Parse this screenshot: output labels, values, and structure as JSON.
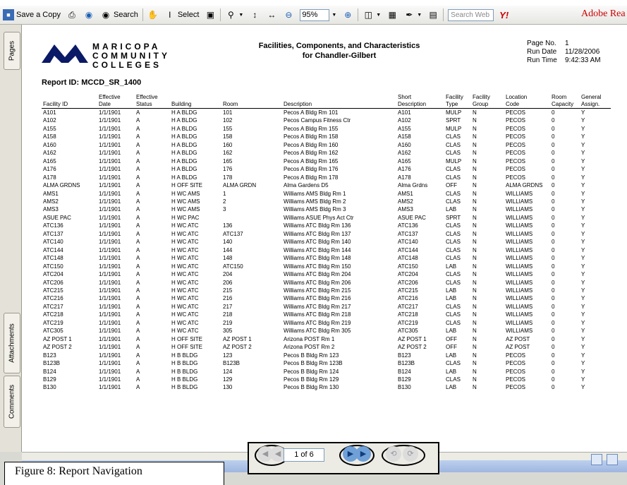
{
  "toolbar": {
    "save_copy": "Save a Copy",
    "search": "Search",
    "select": "Select",
    "zoom": "95%",
    "search_web_placeholder": "Search Web",
    "yahoo": "Y!",
    "adobe": "Adobe Rea"
  },
  "side_tabs": {
    "pages": "Pages",
    "attachments": "Attachments",
    "comments": "Comments"
  },
  "report": {
    "logo_lines": [
      "MARICOPA",
      "COMMUNITY",
      "COLLEGES"
    ],
    "report_id": "Report ID: MCCD_SR_1400",
    "title_line1": "Facilities, Components, and Characteristics",
    "title_line2": "for Chandler-Gilbert",
    "page_no_label": "Page No.",
    "page_no": "1",
    "run_date_label": "Run Date",
    "run_date": "11/28/2006",
    "run_time_label": "Run Time",
    "run_time": "9:42:33 AM",
    "headers": [
      [
        "",
        "Facility ID"
      ],
      [
        "Effective",
        "Date"
      ],
      [
        "Effective",
        "Status"
      ],
      [
        "",
        "Building"
      ],
      [
        "",
        "Room"
      ],
      [
        "",
        "Description"
      ],
      [
        "Short",
        "Description"
      ],
      [
        "Facility",
        "Type"
      ],
      [
        "Facility",
        "Group"
      ],
      [
        "Location",
        "Code"
      ],
      [
        "Room",
        "Capacity"
      ],
      [
        "General",
        "Assign."
      ]
    ],
    "rows": [
      [
        "A101",
        "1/1/1901",
        "A",
        "H A BLDG",
        "101",
        "Pecos A Bldg Rm 101",
        "A101",
        "MULP",
        "N",
        "PECOS",
        "0",
        "Y"
      ],
      [
        "A102",
        "1/1/1901",
        "A",
        "H A BLDG",
        "102",
        "Pecos Campus Fitness Ctr",
        "A102",
        "SPRT",
        "N",
        "PECOS",
        "0",
        "Y"
      ],
      [
        "A155",
        "1/1/1901",
        "A",
        "H A BLDG",
        "155",
        "Pecos A Bldg Rm 155",
        "A155",
        "MULP",
        "N",
        "PECOS",
        "0",
        "Y"
      ],
      [
        "A158",
        "1/1/1901",
        "A",
        "H A BLDG",
        "158",
        "Pecos A Bldg Rm 158",
        "A158",
        "CLAS",
        "N",
        "PECOS",
        "0",
        "Y"
      ],
      [
        "A160",
        "1/1/1901",
        "A",
        "H A BLDG",
        "160",
        "Pecos A Bldg Rm 160",
        "A160",
        "CLAS",
        "N",
        "PECOS",
        "0",
        "Y"
      ],
      [
        "A162",
        "1/1/1901",
        "A",
        "H A BLDG",
        "162",
        "Pecos A Bldg Rm 162",
        "A162",
        "CLAS",
        "N",
        "PECOS",
        "0",
        "Y"
      ],
      [
        "A165",
        "1/1/1901",
        "A",
        "H A BLDG",
        "165",
        "Pecos A Bldg Rm 165",
        "A165",
        "MULP",
        "N",
        "PECOS",
        "0",
        "Y"
      ],
      [
        "A176",
        "1/1/1901",
        "A",
        "H A BLDG",
        "176",
        "Pecos A Bldg Rm 176",
        "A176",
        "CLAS",
        "N",
        "PECOS",
        "0",
        "Y"
      ],
      [
        "A178",
        "1/1/1901",
        "A",
        "H A BLDG",
        "178",
        "Pecos A Bldg Rm 178",
        "A178",
        "CLAS",
        "N",
        "PECOS",
        "0",
        "Y"
      ],
      [
        "ALMA GRDNS",
        "1/1/1901",
        "A",
        "H OFF SITE",
        "ALMA GRDN",
        "Alma Gardens D5",
        "Alma Grdns",
        "OFF",
        "N",
        "ALMA GRDNS",
        "0",
        "Y"
      ],
      [
        "AMS1",
        "1/1/1901",
        "A",
        "H WC AMS",
        "1",
        "Williams AMS Bldg Rm 1",
        "AMS1",
        "CLAS",
        "N",
        "WILLIAMS",
        "0",
        "Y"
      ],
      [
        "AMS2",
        "1/1/1901",
        "A",
        "H WC AMS",
        "2",
        "Williams AMS Bldg Rm 2",
        "AMS2",
        "CLAS",
        "N",
        "WILLIAMS",
        "0",
        "Y"
      ],
      [
        "AMS3",
        "1/1/1901",
        "A",
        "H WC AMS",
        "3",
        "Williams AMS Bldg Rm 3",
        "AMS3",
        "LAB",
        "N",
        "WILLIAMS",
        "0",
        "Y"
      ],
      [
        "ASUE PAC",
        "1/1/1901",
        "A",
        "H WC PAC",
        "",
        "Williams ASUE Phys Act Ctr",
        "ASUE PAC",
        "SPRT",
        "N",
        "WILLIAMS",
        "0",
        "Y"
      ],
      [
        "ATC136",
        "1/1/1901",
        "A",
        "H WC ATC",
        "136",
        "Williams ATC Bldg Rm 136",
        "ATC136",
        "CLAS",
        "N",
        "WILLIAMS",
        "0",
        "Y"
      ],
      [
        "ATC137",
        "1/1/1901",
        "A",
        "H WC ATC",
        "ATC137",
        "Williams ATC Bldg Rm 137",
        "ATC137",
        "CLAS",
        "N",
        "WILLIAMS",
        "0",
        "Y"
      ],
      [
        "ATC140",
        "1/1/1901",
        "A",
        "H WC ATC",
        "140",
        "Williams ATC Bldg Rm 140",
        "ATC140",
        "CLAS",
        "N",
        "WILLIAMS",
        "0",
        "Y"
      ],
      [
        "ATC144",
        "1/1/1901",
        "A",
        "H WC ATC",
        "144",
        "Williams ATC Bldg Rm 144",
        "ATC144",
        "CLAS",
        "N",
        "WILLIAMS",
        "0",
        "Y"
      ],
      [
        "ATC148",
        "1/1/1901",
        "A",
        "H WC ATC",
        "148",
        "Williams ATC Bldg Rm 148",
        "ATC148",
        "CLAS",
        "N",
        "WILLIAMS",
        "0",
        "Y"
      ],
      [
        "ATC150",
        "1/1/1901",
        "A",
        "H WC ATC",
        "ATC150",
        "Williams ATC Bldg Rm 150",
        "ATC150",
        "LAB",
        "N",
        "WILLIAMS",
        "0",
        "Y"
      ],
      [
        "ATC204",
        "1/1/1901",
        "A",
        "H WC ATC",
        "204",
        "Williams ATC Bldg Rm 204",
        "ATC204",
        "CLAS",
        "N",
        "WILLIAMS",
        "0",
        "Y"
      ],
      [
        "ATC206",
        "1/1/1901",
        "A",
        "H WC ATC",
        "206",
        "Williams ATC Bldg Rm 206",
        "ATC206",
        "CLAS",
        "N",
        "WILLIAMS",
        "0",
        "Y"
      ],
      [
        "ATC215",
        "1/1/1901",
        "A",
        "H WC ATC",
        "215",
        "Williams ATC Bldg Rm 215",
        "ATC215",
        "LAB",
        "N",
        "WILLIAMS",
        "0",
        "Y"
      ],
      [
        "ATC216",
        "1/1/1901",
        "A",
        "H WC ATC",
        "216",
        "Williams ATC Bldg Rm 216",
        "ATC216",
        "LAB",
        "N",
        "WILLIAMS",
        "0",
        "Y"
      ],
      [
        "ATC217",
        "1/1/1901",
        "A",
        "H WC ATC",
        "217",
        "Williams ATC Bldg Rm 217",
        "ATC217",
        "CLAS",
        "N",
        "WILLIAMS",
        "0",
        "Y"
      ],
      [
        "ATC218",
        "1/1/1901",
        "A",
        "H WC ATC",
        "218",
        "Williams ATC Bldg Rm 218",
        "ATC218",
        "CLAS",
        "N",
        "WILLIAMS",
        "0",
        "Y"
      ],
      [
        "ATC219",
        "1/1/1901",
        "A",
        "H WC ATC",
        "219",
        "Williams ATC Bldg Rm 219",
        "ATC219",
        "CLAS",
        "N",
        "WILLIAMS",
        "0",
        "Y"
      ],
      [
        "ATC305",
        "1/1/1901",
        "A",
        "H WC ATC",
        "305",
        "Williams ATC Bldg Rm 305",
        "ATC305",
        "LAB",
        "N",
        "WILLIAMS",
        "0",
        "Y"
      ],
      [
        "AZ POST 1",
        "1/1/1901",
        "A",
        "H OFF SITE",
        "AZ POST 1",
        "Arizona POST Rm 1",
        "AZ POST 1",
        "OFF",
        "N",
        "AZ POST",
        "0",
        "Y"
      ],
      [
        "AZ POST 2",
        "1/1/1901",
        "A",
        "H OFF SITE",
        "AZ POST 2",
        "Arizona POST Rm 2",
        "AZ POST 2",
        "OFF",
        "N",
        "AZ POST",
        "0",
        "Y"
      ],
      [
        "B123",
        "1/1/1901",
        "A",
        "H B BLDG",
        "123",
        "Pecos B Bldg Rm 123",
        "B123",
        "LAB",
        "N",
        "PECOS",
        "0",
        "Y"
      ],
      [
        "B123B",
        "1/1/1901",
        "A",
        "H B BLDG",
        "B123B",
        "Pecos B Bldg Rm 123B",
        "B123B",
        "CLAS",
        "N",
        "PECOS",
        "0",
        "Y"
      ],
      [
        "B124",
        "1/1/1901",
        "A",
        "H B BLDG",
        "124",
        "Pecos B Bldg Rm 124",
        "B124",
        "LAB",
        "N",
        "PECOS",
        "0",
        "Y"
      ],
      [
        "B129",
        "1/1/1901",
        "A",
        "H B BLDG",
        "129",
        "Pecos B Bldg Rm 129",
        "B129",
        "CLAS",
        "N",
        "PECOS",
        "0",
        "Y"
      ],
      [
        "B130",
        "1/1/1901",
        "A",
        "H B BLDG",
        "130",
        "Pecos B Bldg Rm 130",
        "B130",
        "LAB",
        "N",
        "PECOS",
        "0",
        "Y"
      ]
    ]
  },
  "navigation": {
    "page_field": "1 of 6"
  },
  "caption": "Figure 8: Report Navigation"
}
